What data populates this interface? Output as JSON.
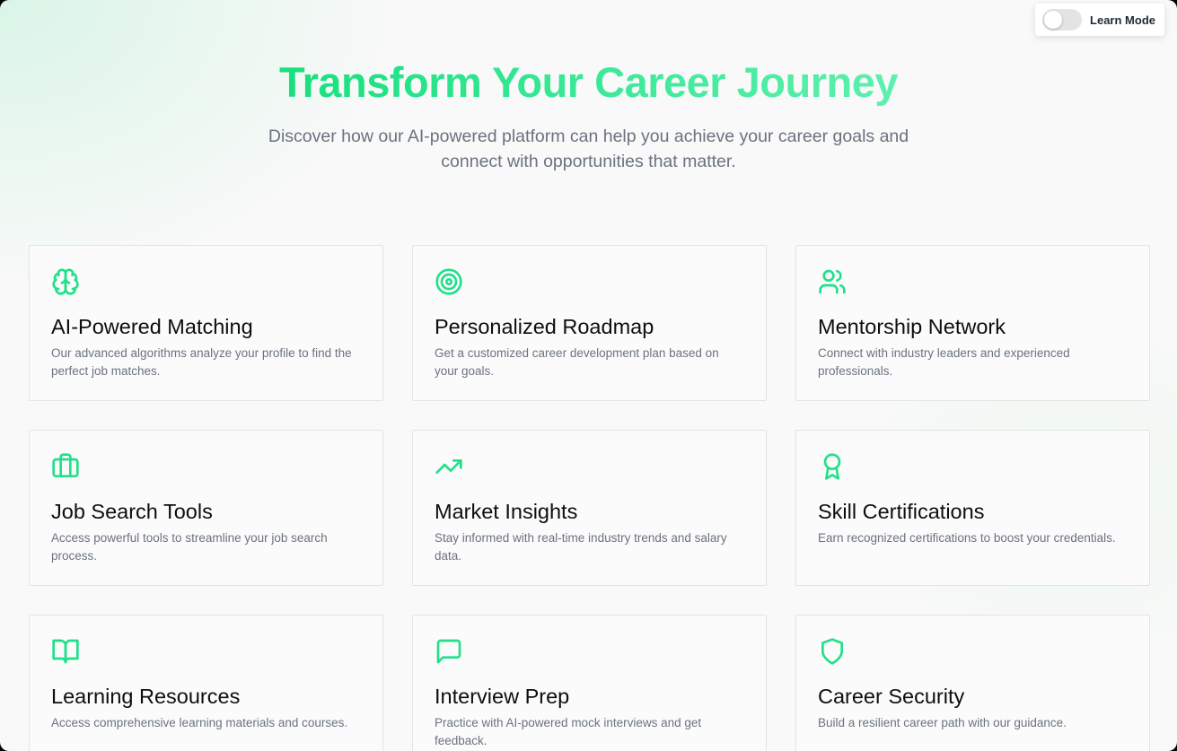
{
  "colors": {
    "accent": "#22e08a",
    "title_text": "#0c0f0e",
    "muted_text": "#6b7280",
    "card_border": "#e2e4e3",
    "background": "#f8f9f8"
  },
  "toggle": {
    "label": "Learn Mode",
    "enabled": false
  },
  "hero": {
    "title": "Transform Your Career Journey",
    "subtitle": "Discover how our AI-powered platform can help you achieve your career goals and connect with opportunities that matter."
  },
  "features": [
    {
      "icon": "brain-icon",
      "title": "AI-Powered Matching",
      "description": "Our advanced algorithms analyze your profile to find the perfect job matches."
    },
    {
      "icon": "target-icon",
      "title": "Personalized Roadmap",
      "description": "Get a customized career development plan based on your goals."
    },
    {
      "icon": "users-icon",
      "title": "Mentorship Network",
      "description": "Connect with industry leaders and experienced professionals."
    },
    {
      "icon": "briefcase-icon",
      "title": "Job Search Tools",
      "description": "Access powerful tools to streamline your job search process."
    },
    {
      "icon": "trending-up-icon",
      "title": "Market Insights",
      "description": "Stay informed with real-time industry trends and salary data."
    },
    {
      "icon": "award-icon",
      "title": "Skill Certifications",
      "description": "Earn recognized certifications to boost your credentials."
    },
    {
      "icon": "book-open-icon",
      "title": "Learning Resources",
      "description": "Access comprehensive learning materials and courses."
    },
    {
      "icon": "message-square-icon",
      "title": "Interview Prep",
      "description": "Practice with AI-powered mock interviews and get feedback."
    },
    {
      "icon": "shield-icon",
      "title": "Career Security",
      "description": "Build a resilient career path with our guidance."
    }
  ]
}
